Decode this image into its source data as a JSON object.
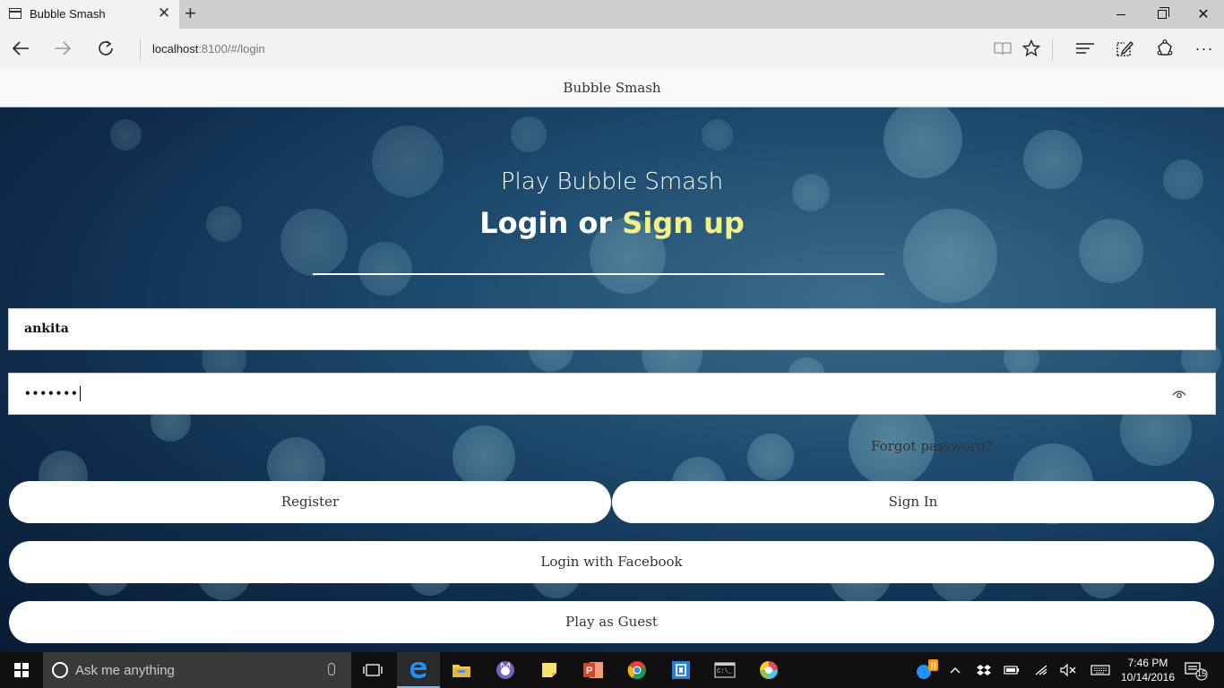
{
  "browser": {
    "tab_title": "Bubble Smash",
    "url_host": "localhost",
    "url_rest": ":8100/#/login"
  },
  "app": {
    "header_title": "Bubble Smash",
    "hero_subtitle": "Play Bubble Smash",
    "hero_title_prefix": "Login or",
    "hero_title_accent": "Sign up",
    "username_value": "ankita",
    "password_mask": "•••••••",
    "forgot_label": "Forgot password?",
    "register_label": "Register",
    "signin_label": "Sign In",
    "facebook_label": "Login with Facebook",
    "guest_label": "Play as Guest"
  },
  "taskbar": {
    "search_placeholder": "Ask me anything",
    "time": "7:46 PM",
    "date": "10/14/2016",
    "notification_count": "15"
  },
  "colors": {
    "accent_signup": "#f4f08a",
    "background_dark": "#0e2b4a",
    "button_bg": "#ffffff"
  }
}
